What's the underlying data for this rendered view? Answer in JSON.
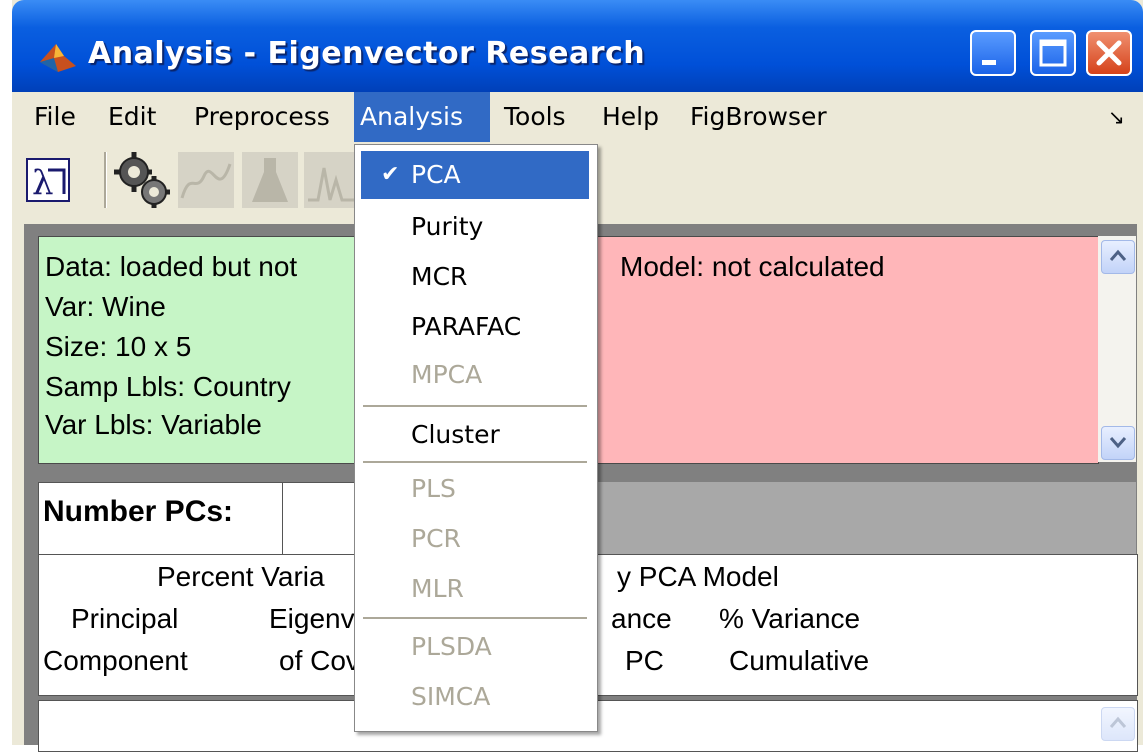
{
  "window": {
    "title": "Analysis - Eigenvector Research"
  },
  "menubar": {
    "items": [
      "File",
      "Edit",
      "Preprocess",
      "Analysis",
      "Tools",
      "Help",
      "FigBrowser"
    ],
    "active": "Analysis",
    "corner_glyph": "↘"
  },
  "toolbar": {
    "icons": [
      "lambda-icon",
      "gears-icon",
      "spectrum-icon",
      "flask-icon",
      "peaks-icon"
    ]
  },
  "data_panel": {
    "lines": [
      "Data: loaded but not",
      "Var: Wine",
      "Size: 10 x 5",
      "Samp Lbls: Country",
      "Var Lbls: Variable"
    ],
    "color": "#c6f5c6"
  },
  "model_panel": {
    "text": "Model: not calculated",
    "color": "#ffb6b9"
  },
  "pcs": {
    "label": "Number PCs:"
  },
  "variance_table": {
    "title_left": "Percent Varia",
    "title_right": "y PCA Model",
    "header_row1": [
      "Principal",
      "Eigenv",
      "ance",
      "% Variance"
    ],
    "header_row2": [
      "Component",
      "of Cov",
      "PC",
      "Cumulative"
    ]
  },
  "analysis_menu": {
    "items": [
      {
        "label": "PCA",
        "checked": true,
        "enabled": true
      },
      {
        "label": "Purity",
        "enabled": true
      },
      {
        "label": "MCR",
        "enabled": true
      },
      {
        "label": "PARAFAC",
        "enabled": true
      },
      {
        "label": "MPCA",
        "enabled": false
      },
      {
        "label": "Cluster",
        "enabled": true
      },
      {
        "label": "PLS",
        "enabled": false
      },
      {
        "label": "PCR",
        "enabled": false
      },
      {
        "label": "MLR",
        "enabled": false
      },
      {
        "label": "PLSDA",
        "enabled": false
      },
      {
        "label": "SIMCA",
        "enabled": false
      }
    ],
    "check_glyph": "✔"
  },
  "colors": {
    "title_blue": "#0050d8",
    "selection": "#316ac5",
    "disabled_text": "#aca899"
  }
}
